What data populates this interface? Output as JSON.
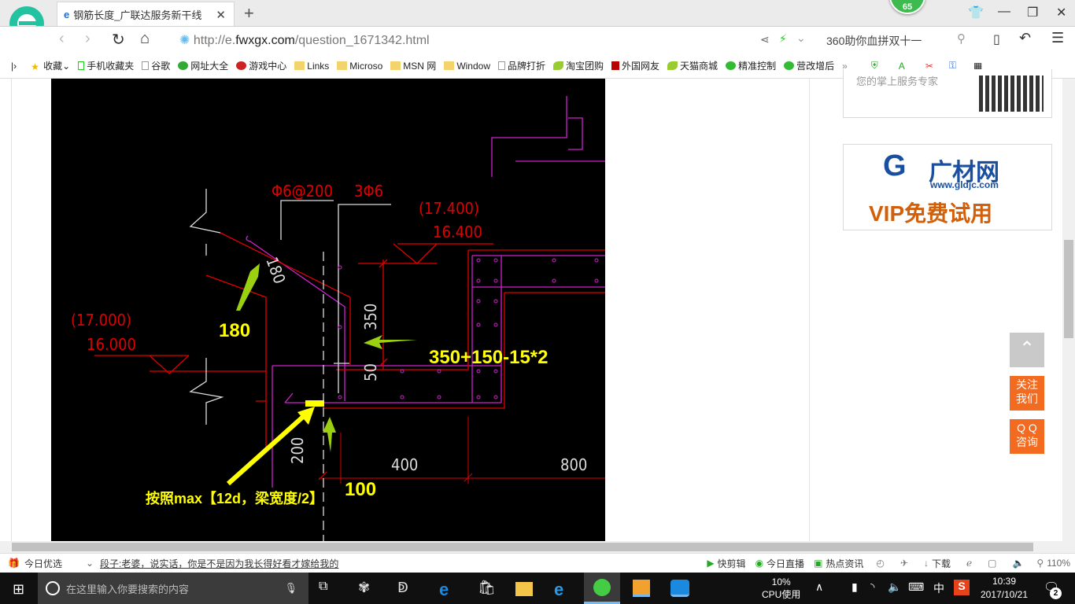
{
  "browser": {
    "tab_title": "钢筋长度_广联达服务新干线",
    "notification_count": "65",
    "url_prefix": "http://e.",
    "url_domain": "fwxgx.com",
    "url_path": "/question_1671342.html",
    "search_text": "360助你血拼双十一",
    "bookmarks": [
      "收藏",
      "手机收藏夹",
      "谷歌",
      "网址大全",
      "游戏中心",
      "Links",
      "Microso",
      "MSN 网",
      "Window",
      "品牌打折",
      "淘宝团购",
      "外国网友",
      "天猫商城",
      "精准控制",
      "营改增后"
    ],
    "more": "»"
  },
  "drawing": {
    "rebar1": "Φ6@200",
    "rebar2": "3Φ6",
    "elev_top_paren": "(17.400)",
    "elev_top": "16.400",
    "elev_left_paren": "(17.000)",
    "elev_left": "16.000",
    "dim_180": "180",
    "dim_350": "350",
    "dim_50": "50",
    "dim_200": "200",
    "dim_400": "400",
    "dim_800": "800",
    "note_180": "180",
    "note_formula": "350+150-15*2",
    "note_100": "100",
    "note_rule": "按照max【12d，梁宽度/2】"
  },
  "sidebar": {
    "app_text": "您的掌上服务专家",
    "ad_brand": "广材网",
    "ad_url": "www.gldjc.com",
    "ad_slogan": "VIP免费试用",
    "float_follow": "关注我们",
    "float_qq": "Q Q咨询"
  },
  "statusbar": {
    "today": "今日优选",
    "news": "段子:老婆，说实话，你是不是因为我长得好看才嫁给我的",
    "items": [
      "快剪辑",
      "今日直播",
      "热点资讯",
      "下载"
    ],
    "zoom": "110%"
  },
  "taskbar": {
    "search_placeholder": "在这里输入你要搜索的内容",
    "cpu_percent": "10%",
    "cpu_label": "CPU使用",
    "ime": "中",
    "time": "10:39",
    "date": "2017/10/21",
    "notifications": "2"
  },
  "colors": {
    "cad_red": "#e00000",
    "cad_magenta": "#d020d0",
    "annot_yellow": "#ffff00",
    "arrow_green": "#9ad010",
    "accent_orange": "#f36b20"
  }
}
